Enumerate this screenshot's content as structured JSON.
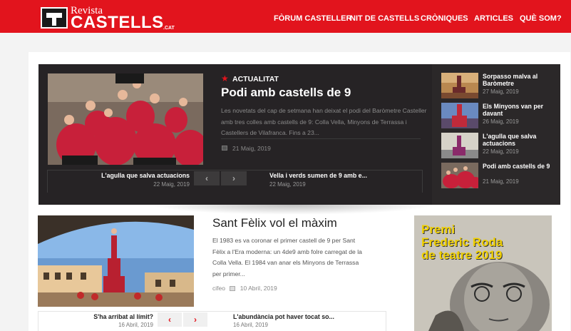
{
  "header": {
    "logo_top": "Revista",
    "logo_main": "CASTELLS",
    "logo_suffix": ".CAT",
    "nav": [
      "FÒRUM CASTELLER",
      "NIT DE CASTELLS",
      "CRÒNIQUES",
      "ARTICLES",
      "QUÈ SOM?"
    ]
  },
  "featured": {
    "category": "ACTUALITAT",
    "title": "Podi amb castells de 9",
    "excerpt": "Les novetats del cap de setmana han deixat el podi del Baròmetre Casteller amb tres colles amb castells de 9: Colla Vella, Minyons de Terrassa i Castellers de Vilafranca. Fins a 23...",
    "date": "21 Maig, 2019",
    "prev": {
      "title": "L'agulla que salva actuacions",
      "date": "22 Maig, 2019"
    },
    "next": {
      "title": "Vella i verds sumen de 9 amb e...",
      "date": "22 Maig, 2019"
    },
    "arrows": {
      "prev": "‹",
      "next": "›"
    }
  },
  "sidebar": [
    {
      "title": "Sorpasso malva al Baròmetre",
      "date": "27 Maig, 2019",
      "icon": "human-tower-photo"
    },
    {
      "title": "Els Minyons van per davant",
      "date": "26 Maig, 2019",
      "icon": "human-tower-photo"
    },
    {
      "title": "L'agulla que salva actuacions",
      "date": "22 Maig, 2019",
      "icon": "human-tower-photo"
    },
    {
      "title": "Podi amb castells de 9",
      "date": "21 Maig, 2019",
      "icon": "human-tower-photo"
    }
  ],
  "post": {
    "title": "Sant Fèlix vol el màxim",
    "excerpt": "El 1983 es va coronar el primer castell de 9 per Sant Fèlix a l'Era moderna: un 4de9 amb folre carregat de la Colla Vella. El 1984 van anar els Minyons de Terrassa per primer...",
    "author": "cifeo",
    "date": "10 Abril, 2019",
    "prev": {
      "title": "S'ha arribat al límit?",
      "date": "16 Abril, 2019"
    },
    "next": {
      "title": "L'abundància pot haver tocat so...",
      "date": "16 Abril, 2019"
    },
    "arrows": {
      "prev": "‹",
      "next": "›"
    }
  },
  "ad": {
    "lines": [
      "Premi",
      "Frederic Roda",
      "de teatre 2019"
    ]
  },
  "colors": {
    "brand_red": "#e2141d",
    "dark": "#262325",
    "ad_yellow": "#f0d000"
  }
}
